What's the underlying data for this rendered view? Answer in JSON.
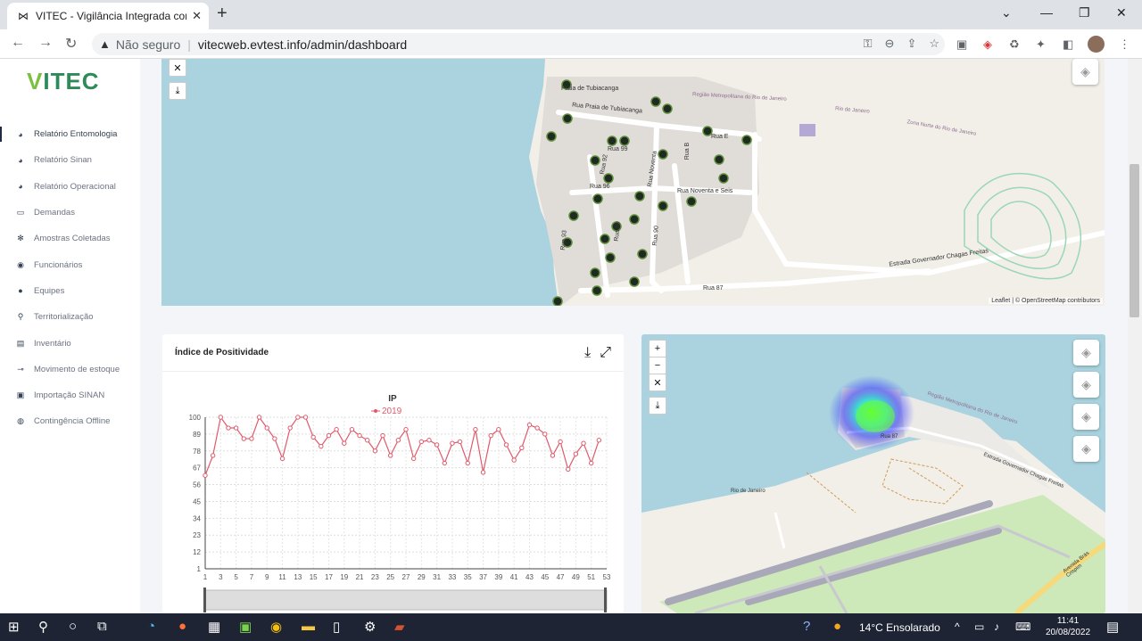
{
  "browser": {
    "tab_title": "VITEC - Vigilância Integrada com",
    "tab_close": "✕",
    "new_tab": "+",
    "security_label": "Não seguro",
    "url": "vitecweb.evtest.info/admin/dashboard"
  },
  "app": {
    "logo": "VITEC"
  },
  "sidebar": {
    "items": [
      {
        "label": "Relatório Entomologia",
        "icon": "pie-chart-icon"
      },
      {
        "label": "Relatório Sinan",
        "icon": "pie-chart-icon"
      },
      {
        "label": "Relatório Operacional",
        "icon": "pie-chart-icon"
      },
      {
        "label": "Demandas",
        "icon": "monitor-icon"
      },
      {
        "label": "Amostras Coletadas",
        "icon": "gear-icon"
      },
      {
        "label": "Funcionários",
        "icon": "user-circle-icon"
      },
      {
        "label": "Equipes",
        "icon": "user-icon"
      },
      {
        "label": "Territorialização",
        "icon": "map-pin-icon"
      },
      {
        "label": "Inventário",
        "icon": "archive-icon"
      },
      {
        "label": "Movimento de estoque",
        "icon": "dolly-icon"
      },
      {
        "label": "Importação SINAN",
        "icon": "lock-icon"
      },
      {
        "label": "Contingência Offline",
        "icon": "user-pin-icon"
      }
    ]
  },
  "map_top": {
    "streets": [
      "Praia de Tubiacanga",
      "Rua Praia de Tubiacanga",
      "Rua 99",
      "Rua 92",
      "Rua 96",
      "Rua Noventa",
      "Rua Noventa e Seis",
      "Rua E",
      "Rua B",
      "Rua 90",
      "Rua 89",
      "Rua 87",
      "Estrada Governador Chagas Freitas",
      "Região Metropolitana do Rio de Janeiro",
      "Rio de Janeiro",
      "Zona Norte do Rio de Janeiro",
      "Rua 93"
    ],
    "attribution": "Leaflet | © OpenStreetMap contributors"
  },
  "map_heat": {
    "zoom_in": "+",
    "zoom_out": "−",
    "streets": [
      "Região Metropolitana do Rio de Janeiro",
      "Estrada Governador Chagas Freitas",
      "Rua 87",
      "Rio de Janeiro",
      "Avenida Brás Crispim"
    ]
  },
  "chart_card": {
    "title": "Índice de Positividade"
  },
  "chart_data": {
    "type": "line",
    "title": "IP",
    "x": [
      1,
      2,
      3,
      4,
      5,
      6,
      7,
      8,
      9,
      10,
      11,
      12,
      13,
      14,
      15,
      16,
      17,
      18,
      19,
      20,
      21,
      22,
      23,
      24,
      25,
      26,
      27,
      28,
      29,
      30,
      31,
      32,
      33,
      34,
      35,
      36,
      37,
      38,
      39,
      40,
      41,
      42,
      43,
      44,
      45,
      46,
      47,
      48,
      49,
      50,
      51,
      52
    ],
    "series": [
      {
        "name": "2019",
        "color": "#e05a6a",
        "values": [
          62,
          75,
          100,
          93,
          93,
          86,
          86,
          100,
          93,
          86,
          73,
          93,
          100,
          100,
          87,
          81,
          88,
          92,
          83,
          92,
          88,
          85,
          78,
          88,
          75,
          85,
          92,
          73,
          84,
          85,
          82,
          70,
          83,
          84,
          70,
          92,
          64,
          88,
          92,
          82,
          72,
          80,
          95,
          93,
          89,
          75,
          84,
          66,
          76,
          83,
          70,
          85
        ]
      }
    ],
    "yticks": [
      1,
      12,
      23,
      34,
      45,
      56,
      67,
      78,
      89,
      100
    ],
    "xticks": [
      1,
      3,
      5,
      7,
      9,
      11,
      13,
      15,
      17,
      19,
      21,
      23,
      25,
      27,
      29,
      31,
      33,
      35,
      37,
      39,
      41,
      43,
      45,
      47,
      49,
      51,
      53
    ],
    "ylim": [
      1,
      100
    ],
    "xlim": [
      1,
      53
    ],
    "grid": true,
    "legend": "top"
  },
  "taskbar": {
    "weather": "14°C  Ensolarado",
    "time": "11:41",
    "date": "20/08/2022"
  }
}
